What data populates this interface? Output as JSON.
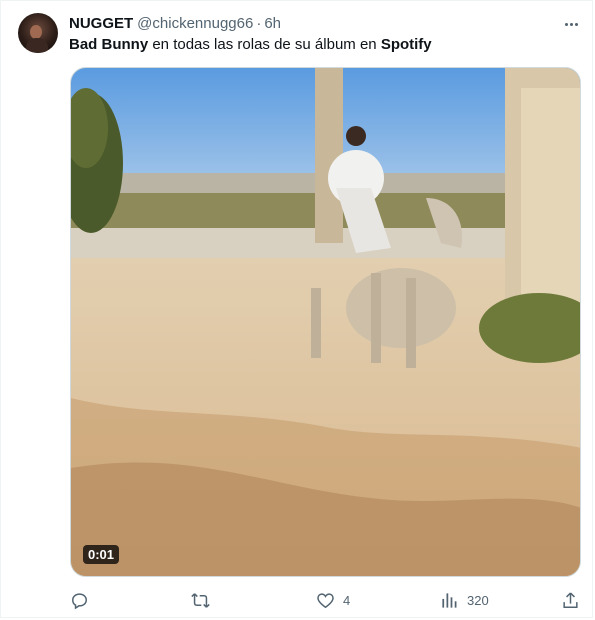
{
  "author": {
    "name": "NUGGET",
    "handle": "@chickennugg66",
    "separator": "·",
    "time": "6h"
  },
  "tweet": {
    "text_part1": "Bad Bunny",
    "text_part2": " en todas las rolas de su álbum en ",
    "text_part3": "Spotify"
  },
  "media": {
    "timestamp": "0:01"
  },
  "actions": {
    "reply_count": "",
    "retweet_count": "",
    "like_count": "4",
    "views_count": "320"
  },
  "icons": {
    "more": "more-horizontal-icon",
    "reply": "reply-icon",
    "retweet": "retweet-icon",
    "like": "heart-icon",
    "views": "views-bar-icon",
    "share": "share-icon"
  },
  "colors": {
    "text": "#0f1419",
    "secondary": "#536471",
    "border": "#eff3f4"
  }
}
